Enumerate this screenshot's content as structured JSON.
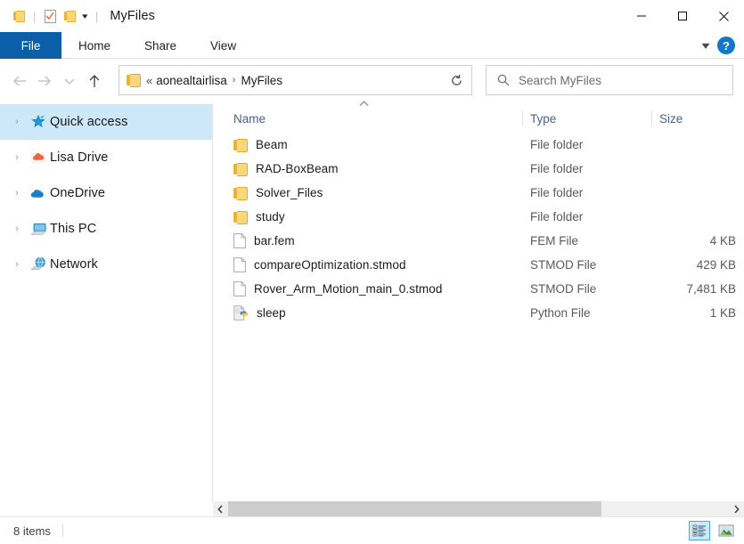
{
  "window": {
    "title": "MyFiles",
    "quick_access_toolbar": [
      "folder-icon",
      "properties-icon",
      "new-folder-icon",
      "customize-caret"
    ],
    "controls": {
      "minimize": "—",
      "maximize": "□",
      "close": "✕"
    }
  },
  "ribbon": {
    "tabs": [
      {
        "label": "File",
        "active": true
      },
      {
        "label": "Home",
        "active": false
      },
      {
        "label": "Share",
        "active": false
      },
      {
        "label": "View",
        "active": false
      }
    ],
    "expand_label": "∨",
    "help_label": "?"
  },
  "navigation": {
    "back_tooltip": "Back",
    "forward_tooltip": "Forward",
    "recent_tooltip": "Recent locations",
    "up_tooltip": "Up",
    "breadcrumb": {
      "overflow": "«",
      "items": [
        "aonealtairlisa",
        "MyFiles"
      ],
      "separator": "›"
    },
    "dropdown_label": "∨",
    "refresh_label": "Refresh"
  },
  "search": {
    "placeholder": "Search MyFiles",
    "icon": "search-icon"
  },
  "sidebar": {
    "items": [
      {
        "label": "Quick access",
        "icon": "pinned-star-icon",
        "selected": true,
        "expander": "›"
      },
      {
        "label": "Lisa Drive",
        "icon": "orange-cloud-icon",
        "selected": false,
        "expander": "›"
      },
      {
        "label": "OneDrive",
        "icon": "onedrive-cloud-icon",
        "selected": false,
        "expander": "›"
      },
      {
        "label": "This PC",
        "icon": "this-pc-icon",
        "selected": false,
        "expander": "›"
      },
      {
        "label": "Network",
        "icon": "network-icon",
        "selected": false,
        "expander": "›"
      }
    ]
  },
  "file_list": {
    "columns": [
      {
        "key": "name",
        "label": "Name",
        "sorted": "asc",
        "sort_glyph": "˄"
      },
      {
        "key": "type",
        "label": "Type"
      },
      {
        "key": "size",
        "label": "Size"
      }
    ],
    "rows": [
      {
        "name": "Beam",
        "type": "File folder",
        "size": "",
        "icon": "folder-icon"
      },
      {
        "name": "RAD-BoxBeam",
        "type": "File folder",
        "size": "",
        "icon": "folder-icon"
      },
      {
        "name": "Solver_Files",
        "type": "File folder",
        "size": "",
        "icon": "folder-icon"
      },
      {
        "name": "study",
        "type": "File folder",
        "size": "",
        "icon": "folder-icon"
      },
      {
        "name": "bar.fem",
        "type": "FEM File",
        "size": "4 KB",
        "icon": "generic-file-icon"
      },
      {
        "name": "compareOptimization.stmod",
        "type": "STMOD File",
        "size": "429 KB",
        "icon": "generic-file-icon"
      },
      {
        "name": "Rover_Arm_Motion_main_0.stmod",
        "type": "STMOD File",
        "size": "7,481 KB",
        "icon": "generic-file-icon"
      },
      {
        "name": "sleep",
        "type": "Python File",
        "size": "1 KB",
        "icon": "python-file-icon"
      }
    ]
  },
  "scrollbar": {
    "left_arrow": "‹",
    "right_arrow": "›",
    "thumb_percent": 74.5
  },
  "statusbar": {
    "item_count": "8 items",
    "views": [
      {
        "name": "details-view",
        "active": true
      },
      {
        "name": "large-icons-view",
        "active": false
      }
    ]
  },
  "colors": {
    "accent": "#0a5fa8",
    "selection": "#cde8f9",
    "help_blue": "#1277c8",
    "folder_yellow": "#fcd778",
    "header_text": "#45618e"
  }
}
